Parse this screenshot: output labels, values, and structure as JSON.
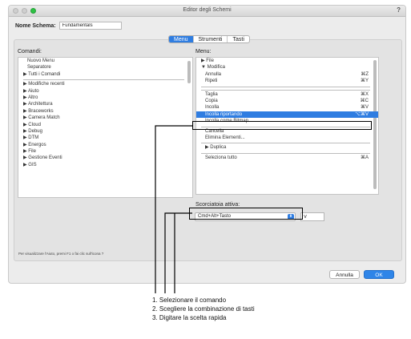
{
  "window": {
    "title": "Editor degli Schemi",
    "help": "?"
  },
  "schema": {
    "label": "Nome Schema:",
    "value": "Fundamentals"
  },
  "tabs": [
    {
      "label": "Menu",
      "active": true
    },
    {
      "label": "Strumenti",
      "active": false
    },
    {
      "label": "Tasti",
      "active": false
    }
  ],
  "commands": {
    "label": "Comandi:",
    "items": [
      {
        "text": "Nuovo Menu",
        "indent": true
      },
      {
        "text": "Separatore",
        "indent": true
      },
      {
        "text": "▶ Tutti i Comandi",
        "indent": false
      },
      {
        "divider": true
      },
      {
        "text": "▶ Modifiche recenti",
        "indent": false
      },
      {
        "text": "▶ Aiuto",
        "indent": false
      },
      {
        "text": "▶ Altro",
        "indent": false
      },
      {
        "text": "▶ Architettura",
        "indent": false
      },
      {
        "text": "▶ Braceworks",
        "indent": false
      },
      {
        "text": "▶ Camera Match",
        "indent": false
      },
      {
        "text": "▶ Cloud",
        "indent": false
      },
      {
        "text": "▶ Debug",
        "indent": false
      },
      {
        "text": "▶ DTM",
        "indent": false
      },
      {
        "text": "▶ Energos",
        "indent": false
      },
      {
        "text": "▶ File",
        "indent": false
      },
      {
        "text": "▶ Gestione Eventi",
        "indent": false
      },
      {
        "text": "▶ GIS",
        "indent": false
      }
    ]
  },
  "menu": {
    "label": "Menu:",
    "items": [
      {
        "text": "▶ File",
        "indent": false,
        "shortcut": ""
      },
      {
        "text": "▼ Modifica",
        "indent": false,
        "shortcut": ""
      },
      {
        "text": "Annulla",
        "indent": true,
        "shortcut": "⌘Z"
      },
      {
        "text": "Ripeti",
        "indent": true,
        "shortcut": "⌘Y"
      },
      {
        "divider": true
      },
      {
        "divider": true
      },
      {
        "text": "Taglia",
        "indent": true,
        "shortcut": "⌘X"
      },
      {
        "text": "Copia",
        "indent": true,
        "shortcut": "⌘C"
      },
      {
        "text": "Incolla",
        "indent": true,
        "shortcut": "⌘V"
      },
      {
        "text": "Incolla riportando",
        "indent": true,
        "shortcut": "⌥⌘V",
        "selected": true
      },
      {
        "text": "Incolla come Bitmap",
        "indent": true,
        "shortcut": ""
      },
      {
        "divider": true
      },
      {
        "text": "Cancella",
        "indent": true,
        "shortcut": ""
      },
      {
        "text": "Elimina Elementi...",
        "indent": true,
        "shortcut": ""
      },
      {
        "divider": true
      },
      {
        "text": "▶ Duplica",
        "indent": true,
        "shortcut": ""
      },
      {
        "divider": true
      },
      {
        "text": "Seleziona tutto",
        "indent": true,
        "shortcut": "⌘A"
      }
    ]
  },
  "shortcut": {
    "label": "Scorciatoia attiva:",
    "modifier": "Cmd+Alt+Tasto",
    "key": "V"
  },
  "hint": "Per visualizzare l'Aiuto, premi F1 o fai clic sull'icona ?",
  "buttons": {
    "cancel": "Annulla",
    "ok": "OK"
  },
  "steps": [
    "1. Selezionare il comando",
    "2. Scegliere la combinazione di tasti",
    "3. Digitare la scelta rapida"
  ]
}
